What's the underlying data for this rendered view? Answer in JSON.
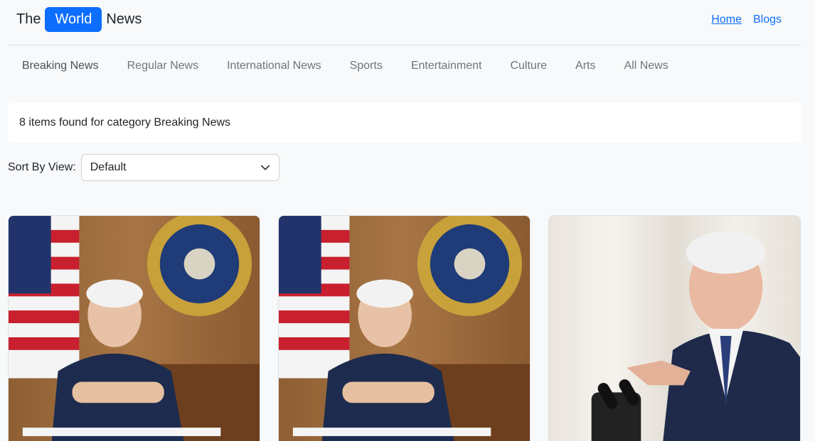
{
  "header": {
    "brand_prefix": "The",
    "brand_highlight": "World",
    "brand_suffix": "News",
    "links": [
      {
        "label": "Home",
        "active": true
      },
      {
        "label": "Blogs",
        "active": false
      }
    ]
  },
  "categories": [
    {
      "label": "Breaking News",
      "active": true
    },
    {
      "label": "Regular News",
      "active": false
    },
    {
      "label": "International News",
      "active": false
    },
    {
      "label": "Sports",
      "active": false
    },
    {
      "label": "Entertainment",
      "active": false
    },
    {
      "label": "Culture",
      "active": false
    },
    {
      "label": "Arts",
      "active": false
    },
    {
      "label": "All News",
      "active": false
    }
  ],
  "results": {
    "message": "8 items found for category Breaking News"
  },
  "sort": {
    "label": "Sort By View:",
    "selected": "Default",
    "icon": "chevron-down-icon"
  },
  "colors": {
    "primary": "#0d6efd",
    "background": "#f8f9fa",
    "nav_text": "#6c757d"
  }
}
